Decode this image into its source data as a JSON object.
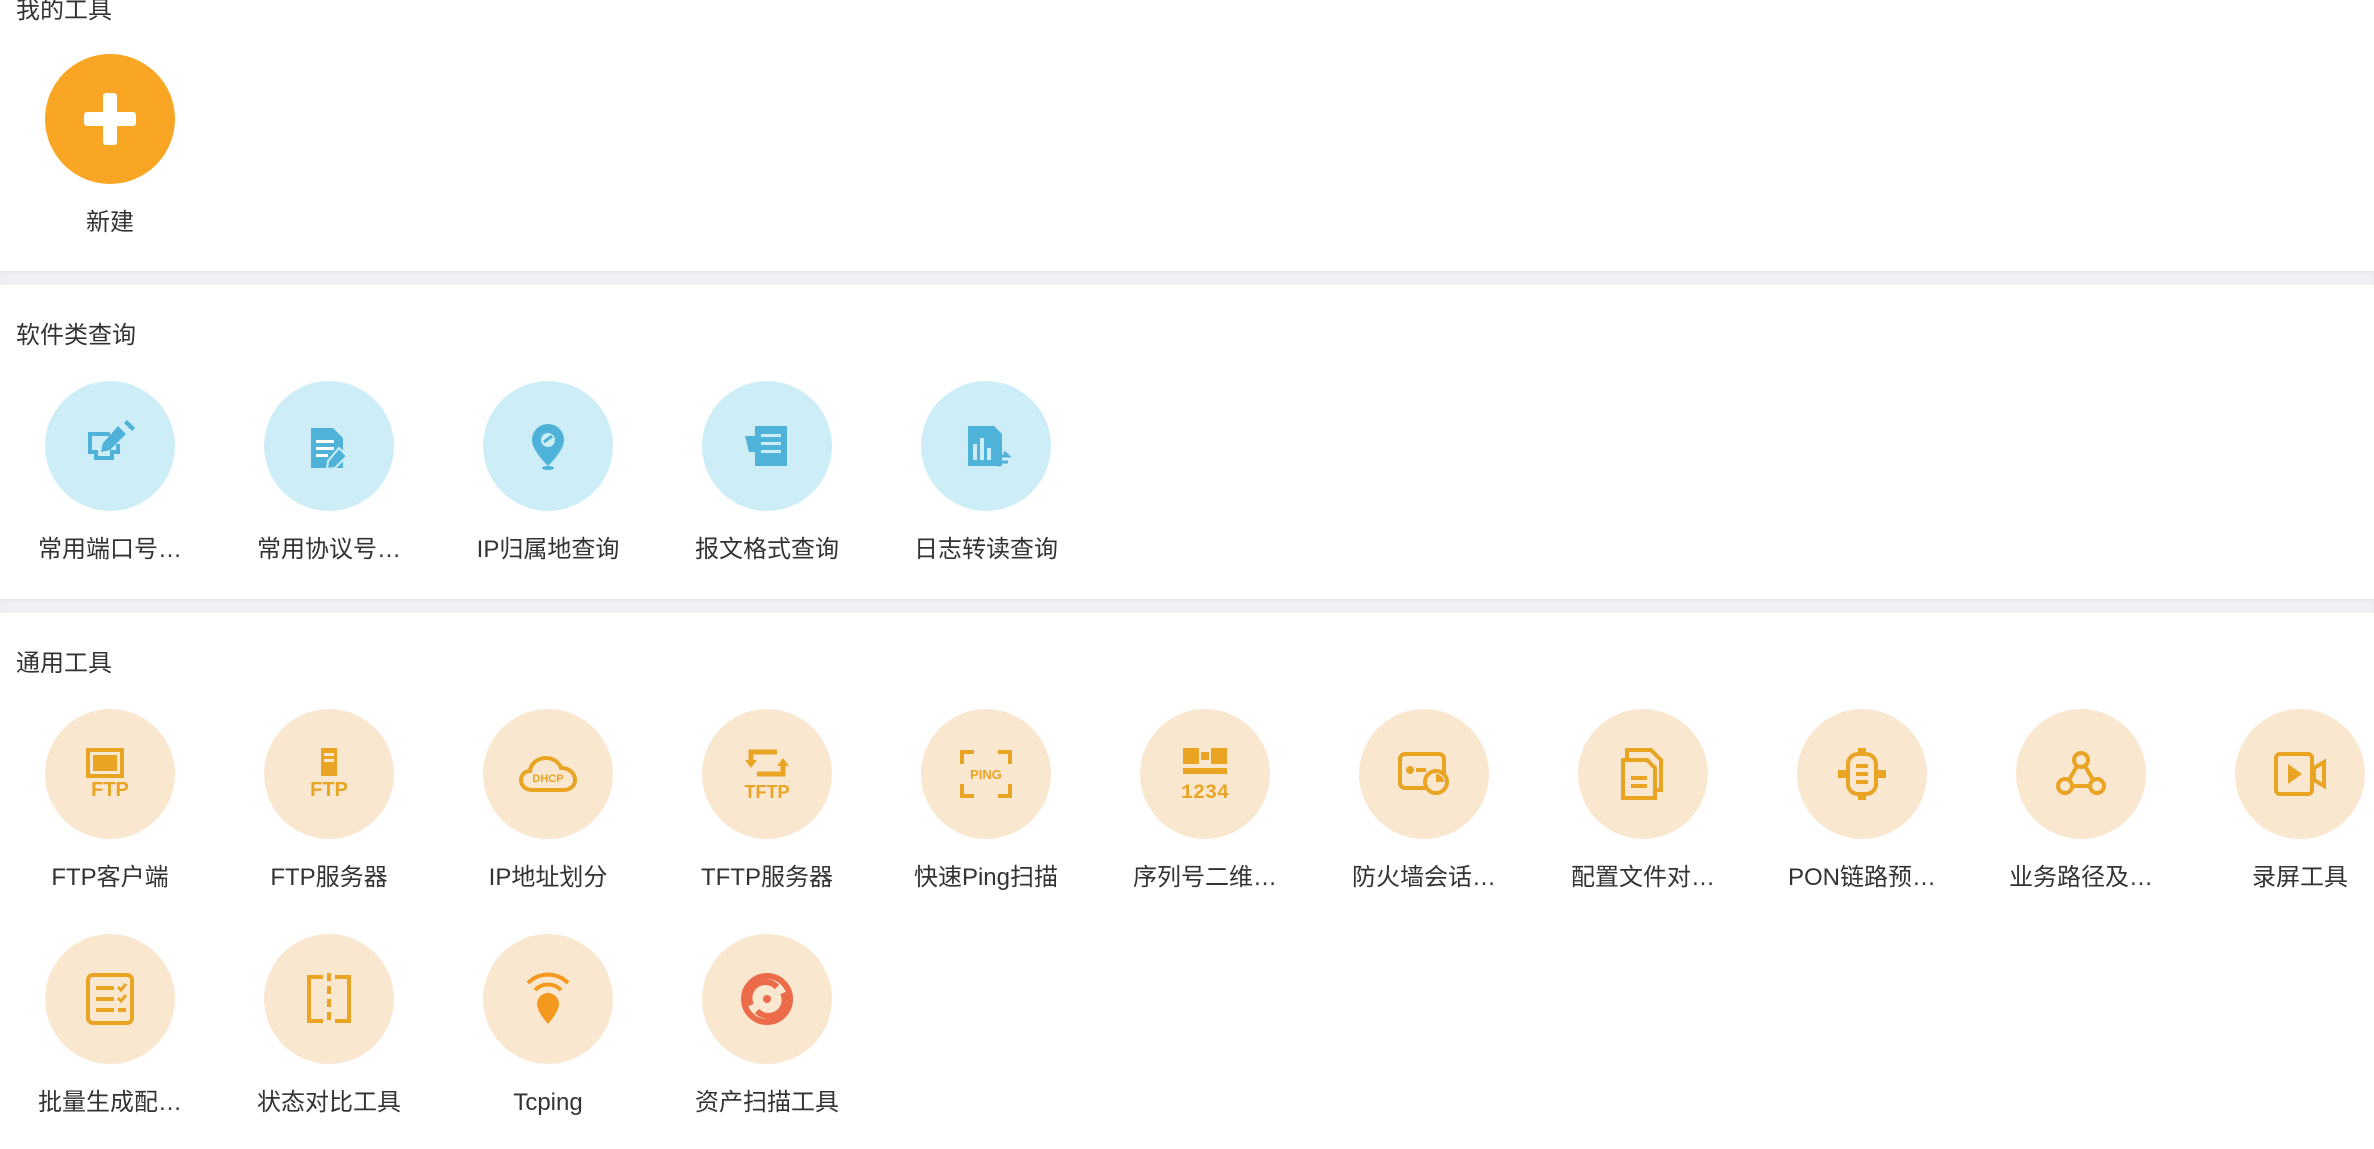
{
  "sections": {
    "my_tools": {
      "title": "我的工具",
      "items": [
        {
          "label": "新建",
          "icon": "plus-icon"
        }
      ]
    },
    "software_query": {
      "title": "软件类查询",
      "items": [
        {
          "label": "常用端口号…",
          "icon": "port-edit-icon"
        },
        {
          "label": "常用协议号…",
          "icon": "protocol-doc-icon"
        },
        {
          "label": "IP归属地查询",
          "icon": "location-pin-icon"
        },
        {
          "label": "报文格式查询",
          "icon": "packet-doc-icon"
        },
        {
          "label": "日志转读查询",
          "icon": "log-chart-icon"
        }
      ]
    },
    "general_tools": {
      "title": "通用工具",
      "items": [
        {
          "label": "FTP客户端",
          "icon": "ftp-client-icon",
          "icon_text": "FTP"
        },
        {
          "label": "FTP服务器",
          "icon": "ftp-server-icon",
          "icon_text": "FTP"
        },
        {
          "label": "IP地址划分",
          "icon": "ip-cloud-icon",
          "icon_text": "DHCP"
        },
        {
          "label": "TFTP服务器",
          "icon": "tftp-server-icon",
          "icon_text": "TFTP"
        },
        {
          "label": "快速Ping扫描",
          "icon": "ping-scan-icon",
          "icon_text": "PING"
        },
        {
          "label": "序列号二维…",
          "icon": "qrcode-serial-icon",
          "icon_text": "1234"
        },
        {
          "label": "防火墙会话…",
          "icon": "firewall-session-icon"
        },
        {
          "label": "配置文件对…",
          "icon": "config-compare-icon"
        },
        {
          "label": "PON链路预…",
          "icon": "pon-link-icon"
        },
        {
          "label": "业务路径及…",
          "icon": "service-path-icon"
        },
        {
          "label": "录屏工具",
          "icon": "screen-record-icon"
        },
        {
          "label": "批量生成配…",
          "icon": "batch-config-icon"
        },
        {
          "label": "状态对比工具",
          "icon": "state-compare-icon"
        },
        {
          "label": "Tcping",
          "icon": "tcping-wifi-pin-icon"
        },
        {
          "label": "资产扫描工具",
          "icon": "asset-scan-icon"
        }
      ]
    }
  },
  "colors": {
    "accent_orange": "#f8a623",
    "blue_circle": "#cdeef7",
    "blue_icon": "#4fb3d9",
    "peach_circle": "#fae7d0",
    "peach_icon": "#e9a424",
    "red_icon": "#ec6b49"
  }
}
